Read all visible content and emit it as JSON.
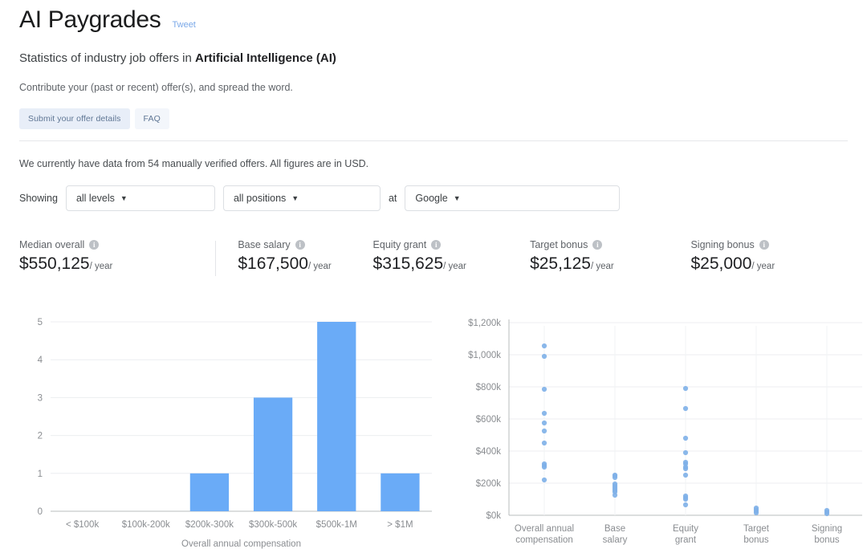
{
  "header": {
    "title": "AI Paygrades",
    "tweet_label": "Tweet",
    "subtitle_prefix": "Statistics of industry job offers in ",
    "subtitle_strong": "Artificial Intelligence (AI)",
    "contribute": "Contribute your (past or recent) offer(s), and spread the word.",
    "submit_button": "Submit your offer details",
    "faq_button": "FAQ"
  },
  "data_note": "We currently have data from 54 manually verified offers. All figures are in USD.",
  "filters": {
    "showing_label": "Showing",
    "at_label": "at",
    "level": {
      "value": "all levels",
      "caret": "chevron-down-icon"
    },
    "position": {
      "value": "all positions",
      "caret": "chevron-down-icon"
    },
    "company": {
      "value": "Google",
      "caret": "chevron-down-icon"
    }
  },
  "stats": [
    {
      "label": "Median overall",
      "value": "$550,125",
      "per": "/ year",
      "info": "info-icon"
    },
    {
      "label": "Base salary",
      "value": "$167,500",
      "per": "/ year",
      "info": "info-icon"
    },
    {
      "label": "Equity grant",
      "value": "$315,625",
      "per": "/ year",
      "info": "info-icon"
    },
    {
      "label": "Target bonus",
      "value": "$25,125",
      "per": "/ year",
      "info": "info-icon"
    },
    {
      "label": "Signing bonus",
      "value": "$25,000",
      "per": "/ year",
      "info": "info-icon"
    }
  ],
  "chart_data": [
    {
      "type": "bar",
      "title": "",
      "categories": [
        "< $100k",
        "$100k-200k",
        "$200k-300k",
        "$300k-500k",
        "$500k-1M",
        "> $1M"
      ],
      "values": [
        0,
        0,
        1,
        3,
        5,
        1
      ],
      "xlabel": "Overall annual compensation",
      "ylabel": "",
      "ylim": [
        0,
        5
      ],
      "yticks": [
        0,
        1,
        2,
        3,
        4,
        5
      ],
      "ytick_labels": [
        "0",
        "1",
        "2",
        "3",
        "4",
        "5"
      ],
      "grid": true,
      "legend": false,
      "bar_color": "#6aabf7"
    },
    {
      "type": "scatter",
      "title": "",
      "categories": [
        "Overall annual\ncompensation",
        "Base\nsalary",
        "Equity\ngrant",
        "Target\nbonus",
        "Signing\nbonus"
      ],
      "xlabel": "",
      "ylabel": "",
      "ylim": [
        0,
        1200
      ],
      "yticks": [
        0,
        200,
        400,
        600,
        800,
        1000,
        1200
      ],
      "ytick_labels": [
        "$0k",
        "$200k",
        "$400k",
        "$600k",
        "$800k",
        "$1,000k",
        "$1,200k"
      ],
      "grid": true,
      "legend": false,
      "point_color": "#7eb0e8",
      "units": "thousands of USD",
      "series": [
        {
          "name": "Overall annual compensation",
          "values": [
            1055,
            990,
            785,
            635,
            575,
            525,
            450,
            320,
            310,
            300,
            220
          ]
        },
        {
          "name": "Base salary",
          "values": [
            250,
            245,
            235,
            195,
            185,
            175,
            165,
            155,
            145,
            125
          ]
        },
        {
          "name": "Equity grant",
          "values": [
            790,
            665,
            480,
            390,
            330,
            320,
            300,
            290,
            250,
            120,
            110,
            100,
            65
          ]
        },
        {
          "name": "Target bonus",
          "values": [
            45,
            35,
            25,
            15
          ]
        },
        {
          "name": "Signing bonus",
          "values": [
            30,
            20,
            10
          ]
        }
      ]
    }
  ]
}
